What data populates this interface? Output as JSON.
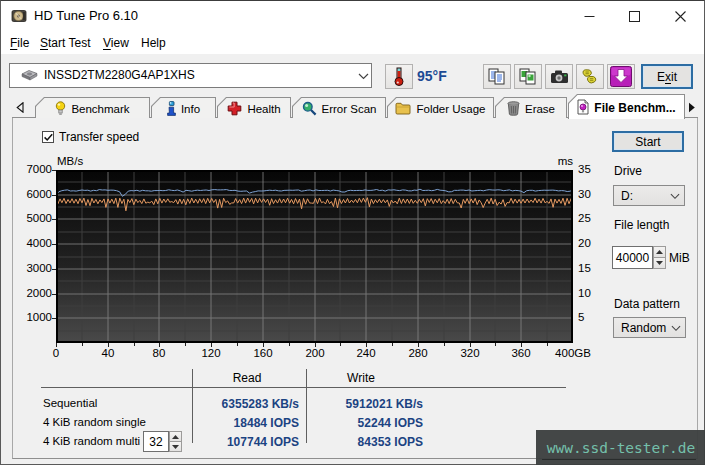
{
  "window": {
    "title": "HD Tune Pro 6.10",
    "controls": {
      "minimize": "minimize",
      "maximize": "maximize",
      "close": "close"
    }
  },
  "menu": [
    {
      "label": "File",
      "u": 0
    },
    {
      "label": "Start Test",
      "u": 0
    },
    {
      "label": "View",
      "u": 0
    },
    {
      "label": "Help",
      "u": -1
    }
  ],
  "toolbar": {
    "device_select": {
      "value": "INSSD2TM2280G4AP1XHS",
      "icon": "disk-icon"
    },
    "temperature_button_icon": "thermometer-icon",
    "temperature": "95°F",
    "buttons": [
      {
        "icon": "copy-text-icon"
      },
      {
        "icon": "copy-image-icon"
      },
      {
        "icon": "screenshot-camera-icon"
      },
      {
        "icon": "donate-hands-icon"
      },
      {
        "icon": "save-download-icon"
      }
    ],
    "exit": {
      "label": "Exit",
      "u": 1
    }
  },
  "tabs": {
    "scroll_left": "scroll-tabs-left",
    "scroll_right": "scroll-tabs-right",
    "items": [
      {
        "label": "Benchmark",
        "icon": "lightbulb-icon",
        "active": false
      },
      {
        "label": "Info",
        "icon": "info-icon",
        "active": false
      },
      {
        "label": "Health",
        "icon": "health-cross-icon",
        "active": false
      },
      {
        "label": "Error Scan",
        "icon": "magnifier-icon",
        "active": false
      },
      {
        "label": "Folder Usage",
        "icon": "folder-icon",
        "active": false
      },
      {
        "label": "Erase",
        "icon": "trash-icon",
        "active": false
      },
      {
        "label": "File Benchm...",
        "icon": "file-benchmark-icon",
        "active": true
      }
    ]
  },
  "panel": {
    "transfer_speed_label": "Transfer speed",
    "transfer_speed_checked": true,
    "start_label": "Start",
    "drive_label": "Drive",
    "drive_value": "D:",
    "file_length_label": "File length",
    "file_length_value": "40000",
    "file_length_unit": "MiB",
    "data_pattern_label": "Data pattern",
    "data_pattern_value": "Random"
  },
  "results": {
    "read_header": "Read",
    "write_header": "Write",
    "rows": [
      {
        "label": "Sequential",
        "read": "6355283 KB/s",
        "write": "5912021 KB/s"
      },
      {
        "label": "4 KiB random single",
        "read": "18484 IOPS",
        "write": "52244 IOPS"
      },
      {
        "label": "4 KiB random multi",
        "read": "107744 IOPS",
        "write": "84353 IOPS"
      }
    ],
    "multi_queue_depth": "32"
  },
  "watermark": "www.ssd-tester.de",
  "colors": {
    "accent_blue_border": "#2d6da3",
    "value_text": "#1b4382",
    "read_line": "#7fa3d4",
    "write_line": "#e59a62",
    "watermark_bg": "#3c4040",
    "watermark_text": "#74c0ab"
  },
  "chart_data": {
    "type": "line",
    "title": "",
    "xlabel_unit": "GB",
    "x_ticks": [
      0,
      40,
      80,
      120,
      160,
      200,
      240,
      280,
      320,
      360
    ],
    "x_last_tick_label": "400GB",
    "xlim": [
      0,
      400
    ],
    "y_left_label": "MB/s",
    "y_left_ticks": [
      7000,
      6000,
      5000,
      4000,
      3000,
      2000,
      1000
    ],
    "ylim": [
      0,
      7000
    ],
    "y_right_label": "ms",
    "y_right_ticks": [
      35,
      30,
      25,
      20,
      15,
      10,
      5
    ],
    "y_right_lim": [
      0,
      35
    ],
    "grid_minor_step_x": 20,
    "grid_minor_step_y": 500,
    "series": [
      {
        "name": "read_speed_mbs",
        "color": "#7fa3d4",
        "x": [
          0.0,
          2.2,
          4.5,
          6.7,
          8.9,
          11.2,
          13.4,
          15.6,
          17.9,
          20.1,
          22.3,
          24.6,
          26.8,
          29.1,
          31.3,
          33.5,
          35.8,
          38.0,
          40.2,
          42.5,
          44.7,
          46.9,
          49.2,
          51.4,
          53.6,
          55.9,
          58.1,
          60.3,
          62.6,
          64.8,
          67.0,
          69.3,
          71.5,
          73.7,
          76.0,
          78.2,
          80.4,
          82.7,
          84.9,
          87.2,
          89.4,
          91.6,
          93.9,
          96.1,
          98.3,
          100.6,
          102.8,
          105.0,
          107.3,
          109.5,
          111.7,
          114.0,
          116.2,
          118.4,
          120.7,
          122.9,
          125.1,
          127.4,
          129.6,
          131.8,
          134.1,
          136.3,
          138.5,
          140.8,
          143.0,
          145.3,
          147.5,
          149.7,
          152.0,
          154.2,
          156.4,
          158.7,
          160.9,
          163.1,
          165.4,
          167.6,
          169.8,
          172.1,
          174.3,
          176.5,
          178.8,
          181.0,
          183.2,
          185.5,
          187.7,
          189.9,
          192.2,
          194.4,
          196.6,
          198.9,
          201.1,
          203.4,
          205.6,
          207.8,
          210.1,
          212.3,
          214.5,
          216.8,
          219.0,
          221.2,
          223.5,
          225.7,
          227.9,
          230.2,
          232.4,
          234.6,
          236.9,
          239.1,
          241.3,
          243.6,
          245.8,
          248.0,
          250.3,
          252.5,
          254.7,
          257.0,
          259.2,
          261.5,
          263.7,
          265.9,
          268.2,
          270.4,
          272.6,
          274.9,
          277.1,
          279.3,
          281.6,
          283.8,
          286.0,
          288.3,
          290.5,
          292.7,
          295.0,
          297.2,
          299.4,
          301.7,
          303.9,
          306.1,
          308.4,
          310.6,
          312.8,
          315.1,
          317.3,
          319.6,
          321.8,
          324.0,
          326.3,
          328.5,
          330.7,
          333.0,
          335.2,
          337.4,
          339.7,
          341.9,
          344.1,
          346.4,
          348.6,
          350.8,
          353.1,
          355.3,
          357.5,
          359.8,
          362.0,
          364.2,
          366.5,
          368.7,
          370.9,
          373.2,
          375.4,
          377.7,
          379.9,
          382.1,
          384.4,
          386.6,
          388.8,
          391.1,
          393.3,
          395.5,
          397.8,
          400.0
        ],
        "values": [
          5999,
          6119,
          6162,
          6181,
          6195,
          6151,
          6159,
          6148,
          6170,
          6190,
          6173,
          6184,
          6148,
          6180,
          6164,
          6208,
          6191,
          6195,
          6178,
          6187,
          6182,
          6161,
          6117,
          5935,
          6015,
          6147,
          6165,
          6159,
          6180,
          6141,
          6180,
          6157,
          6158,
          6144,
          6165,
          6167,
          6175,
          6161,
          6172,
          6199,
          6178,
          6168,
          6191,
          6158,
          6106,
          6177,
          6163,
          6143,
          6169,
          6181,
          6172,
          6181,
          6192,
          6170,
          6200,
          6205,
          6196,
          6196,
          6197,
          6208,
          6173,
          6170,
          6178,
          6148,
          6137,
          6145,
          6152,
          6065,
          6107,
          6128,
          6153,
          6152,
          6156,
          6172,
          6182,
          6172,
          6182,
          6157,
          6152,
          6175,
          6178,
          6182,
          6180,
          6188,
          6189,
          6142,
          6161,
          6183,
          6190,
          6154,
          6194,
          6169,
          6169,
          6173,
          6177,
          6150,
          6187,
          6170,
          6154,
          6109,
          6109,
          6164,
          6179,
          6165,
          6172,
          6173,
          6172,
          6193,
          6175,
          6175,
          6186,
          6211,
          6172,
          6181,
          6147,
          6195,
          6187,
          6199,
          6180,
          6165,
          6196,
          6188,
          6160,
          6155,
          6186,
          6179,
          6223,
          6169,
          6176,
          6184,
          6164,
          6178,
          6217,
          6182,
          6175,
          6156,
          6113,
          6121,
          6180,
          6175,
          6186,
          6187,
          6171,
          6192,
          6149,
          6164,
          6172,
          6178,
          6159,
          6186,
          6201,
          6189,
          6187,
          6199,
          6190,
          6164,
          6179,
          6196,
          6155,
          6175,
          6166,
          6145,
          6080,
          6164,
          6179,
          6178,
          6148,
          6166,
          6176,
          6183,
          6177,
          6181,
          6188,
          6176,
          6153,
          6167,
          6158,
          6131,
          6143,
          6208
        ]
      },
      {
        "name": "write_speed_mbs",
        "color": "#e59a62",
        "x": [
          0.0,
          1.5,
          3.1,
          4.6,
          6.2,
          7.7,
          9.3,
          10.8,
          12.4,
          13.9,
          15.4,
          17.0,
          18.5,
          20.1,
          21.6,
          23.2,
          24.7,
          26.3,
          27.8,
          29.3,
          30.9,
          32.4,
          34.0,
          35.5,
          37.1,
          38.6,
          40.2,
          41.7,
          43.2,
          44.8,
          46.3,
          47.9,
          49.4,
          51.0,
          52.5,
          54.1,
          55.6,
          57.1,
          58.7,
          60.2,
          61.8,
          63.3,
          64.9,
          66.4,
          68.0,
          69.5,
          71.0,
          72.6,
          74.1,
          75.7,
          77.2,
          78.8,
          80.3,
          81.9,
          83.4,
          84.9,
          86.5,
          88.0,
          89.6,
          91.1,
          92.7,
          94.2,
          95.8,
          97.3,
          98.8,
          100.4,
          101.9,
          103.5,
          105.0,
          106.6,
          108.1,
          109.7,
          111.2,
          112.7,
          114.3,
          115.8,
          117.4,
          118.9,
          120.5,
          122.0,
          123.6,
          125.1,
          126.6,
          128.2,
          129.7,
          131.3,
          132.8,
          134.4,
          135.9,
          137.5,
          139.0,
          140.5,
          142.1,
          143.6,
          145.2,
          146.7,
          148.3,
          149.8,
          151.4,
          152.9,
          154.4,
          156.0,
          157.5,
          159.1,
          160.6,
          162.2,
          163.7,
          165.3,
          166.8,
          168.3,
          169.9,
          171.4,
          173.0,
          174.5,
          176.1,
          177.6,
          179.2,
          180.7,
          182.2,
          183.8,
          185.3,
          186.9,
          188.4,
          190.0,
          191.5,
          193.1,
          194.6,
          196.1,
          197.7,
          199.2,
          200.8,
          202.3,
          203.9,
          205.4,
          206.9,
          208.5,
          210.0,
          211.6,
          213.1,
          214.7,
          216.2,
          217.8,
          219.3,
          220.8,
          222.4,
          223.9,
          225.5,
          227.0,
          228.6,
          230.1,
          231.7,
          233.2,
          234.7,
          236.3,
          237.8,
          239.4,
          240.9,
          242.5,
          244.0,
          245.6,
          247.1,
          248.6,
          250.2,
          251.7,
          253.3,
          254.8,
          256.4,
          257.9,
          259.5,
          261.0,
          262.5,
          264.1,
          265.6,
          267.2,
          268.7,
          270.3,
          271.8,
          273.4,
          274.9,
          276.4,
          278.0,
          279.5,
          281.1,
          282.6,
          284.2,
          285.7,
          287.3,
          288.8,
          290.3,
          291.9,
          293.4,
          295.0,
          296.5,
          298.1,
          299.6,
          301.2,
          302.7,
          304.2,
          305.8,
          307.3,
          308.9,
          310.4,
          312.0,
          313.5,
          315.1,
          316.6,
          318.1,
          319.7,
          321.2,
          322.8,
          324.3,
          325.9,
          327.4,
          329.0,
          330.5,
          332.0,
          333.6,
          335.1,
          336.7,
          338.2,
          339.8,
          341.3,
          342.9,
          344.4,
          345.9,
          347.5,
          349.0,
          350.6,
          352.1,
          353.7,
          355.2,
          356.8,
          358.3,
          359.8,
          361.4,
          362.9,
          364.5,
          366.0,
          367.6,
          369.1,
          370.7,
          372.2,
          373.7,
          375.3,
          376.8,
          378.4,
          379.9,
          381.5,
          383.0,
          384.6,
          386.1,
          387.6,
          389.2,
          390.7,
          392.3,
          393.8,
          395.4,
          396.9,
          398.5,
          400.0
        ],
        "values": [
          5857,
          5632,
          5832,
          5678,
          5853,
          5646,
          5808,
          5670,
          5840,
          5655,
          5817,
          5637,
          5845,
          5672,
          5861,
          5563,
          5807,
          5556,
          5852,
          5666,
          5809,
          5634,
          5792,
          5680,
          5830,
          5485,
          5832,
          5660,
          5821,
          5641,
          5860,
          5488,
          5860,
          5643,
          5819,
          5350,
          5810,
          5679,
          5842,
          5596,
          5820,
          5680,
          5768,
          5642,
          5830,
          5656,
          5700,
          5672,
          5737,
          5599,
          5831,
          5633,
          5851,
          5659,
          5828,
          5687,
          5836,
          5696,
          5722,
          5680,
          5802,
          5622,
          5825,
          5635,
          5817,
          5593,
          5833,
          5648,
          5865,
          5663,
          5820,
          5654,
          5833,
          5675,
          5843,
          5641,
          5855,
          5668,
          5851,
          5684,
          5812,
          5460,
          5810,
          5483,
          5859,
          5679,
          5750,
          5613,
          5670,
          5665,
          5847,
          5662,
          5802,
          5641,
          5862,
          5660,
          5866,
          5694,
          5849,
          5627,
          5859,
          5667,
          5848,
          5689,
          5836,
          5686,
          5823,
          5572,
          5838,
          5639,
          5800,
          5659,
          5837,
          5662,
          5825,
          5673,
          5858,
          5658,
          5812,
          5633,
          5846,
          5647,
          5821,
          5430,
          5852,
          5615,
          5833,
          5669,
          5660,
          5651,
          5851,
          5640,
          5862,
          5675,
          5717,
          5629,
          5815,
          5637,
          5725,
          5524,
          5866,
          5472,
          5836,
          5646,
          5805,
          5664,
          5848,
          5666,
          5784,
          5679,
          5809,
          5671,
          5853,
          5690,
          5861,
          5694,
          5880,
          5512,
          5825,
          5640,
          5800,
          5676,
          5818,
          5668,
          5805,
          5671,
          5791,
          5529,
          5782,
          5664,
          5745,
          5631,
          5859,
          5646,
          5829,
          5657,
          5825,
          5650,
          5825,
          5653,
          5774,
          5651,
          5815,
          5676,
          5838,
          5547,
          5840,
          5685,
          5841,
          5637,
          5819,
          5673,
          5844,
          5639,
          5760,
          5650,
          5817,
          5639,
          5843,
          5641,
          5816,
          5672,
          5664,
          5461,
          5811,
          5652,
          5844,
          5637,
          5832,
          5665,
          5850,
          5601,
          5789,
          5671,
          5480,
          5657,
          5816,
          5636,
          5857,
          5623,
          5815,
          5565,
          5696,
          5620,
          5802,
          5527,
          5684,
          5669,
          5853,
          5649,
          5824,
          5661,
          5810,
          5654,
          5821,
          5666,
          5826,
          5677,
          5792,
          5685,
          5858,
          5667,
          5818,
          5662,
          5852,
          5668,
          5729,
          5649,
          5831,
          5491,
          5821,
          5662,
          5811,
          5648,
          5860,
          5566,
          5853,
          5636,
          5843,
          5653
        ]
      }
    ]
  }
}
